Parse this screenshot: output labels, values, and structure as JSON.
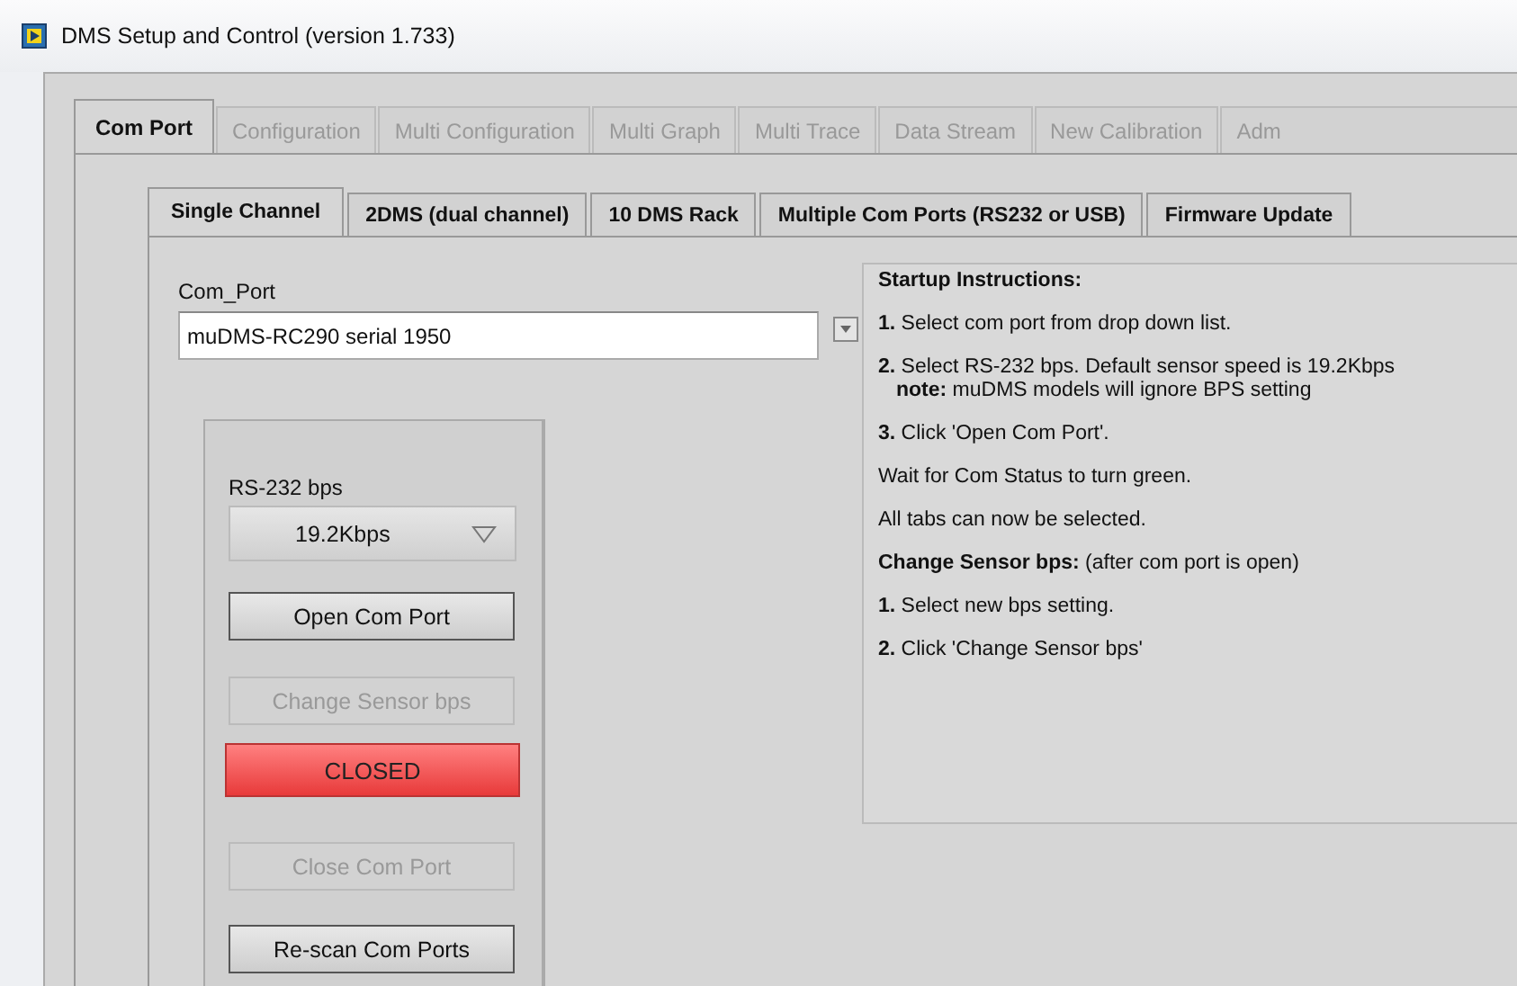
{
  "window": {
    "title": "DMS Setup and Control (version 1.733)"
  },
  "tabs": [
    {
      "label": "Com Port",
      "selected": true,
      "disabled": false
    },
    {
      "label": "Configuration",
      "selected": false,
      "disabled": true
    },
    {
      "label": "Multi Configuration",
      "selected": false,
      "disabled": true
    },
    {
      "label": "Multi Graph",
      "selected": false,
      "disabled": true
    },
    {
      "label": "Multi Trace",
      "selected": false,
      "disabled": true
    },
    {
      "label": "Data Stream",
      "selected": false,
      "disabled": true
    },
    {
      "label": "New Calibration",
      "selected": false,
      "disabled": true
    },
    {
      "label": "Adm",
      "selected": false,
      "disabled": true
    }
  ],
  "subtabs": [
    {
      "label": "Single Channel",
      "selected": true
    },
    {
      "label": "2DMS (dual channel)",
      "selected": false
    },
    {
      "label": "10 DMS Rack",
      "selected": false
    },
    {
      "label": "Multiple Com Ports (RS232 or USB)",
      "selected": false
    },
    {
      "label": "Firmware Update",
      "selected": false
    }
  ],
  "com_port": {
    "label": "Com_Port",
    "value": "muDMS-RC290 serial 1950"
  },
  "bps": {
    "label": "RS-232 bps",
    "value": "19.2Kbps"
  },
  "controls": [
    {
      "kind": "button",
      "label": "Open Com Port",
      "disabled": false
    },
    {
      "kind": "button",
      "label": "Change Sensor bps",
      "disabled": true
    },
    {
      "kind": "indicator",
      "label": "CLOSED",
      "on": false
    },
    {
      "kind": "button",
      "label": "Close Com Port",
      "disabled": true
    },
    {
      "kind": "button",
      "label": "Re-scan Com Ports",
      "disabled": false
    }
  ],
  "instructions": [
    {
      "text": "**Startup Instructions:**"
    },
    {
      "text": "**1.** Select com port from drop down list."
    },
    {
      "text": "**2.** Select RS-232 bps.  Default sensor speed is 19.2Kbps",
      "continuation": "**note:** muDMS models will ignore BPS setting"
    },
    {
      "text": "**3.** Click 'Open Com Port'."
    },
    {
      "text": "Wait for Com Status to turn green."
    },
    {
      "text": "All tabs can now be selected."
    },
    {
      "text": "**Change Sensor bps:** (after com port is open)"
    },
    {
      "text": "**1.** Select new bps setting."
    },
    {
      "text": "**2.** Click 'Change Sensor bps'"
    }
  ]
}
